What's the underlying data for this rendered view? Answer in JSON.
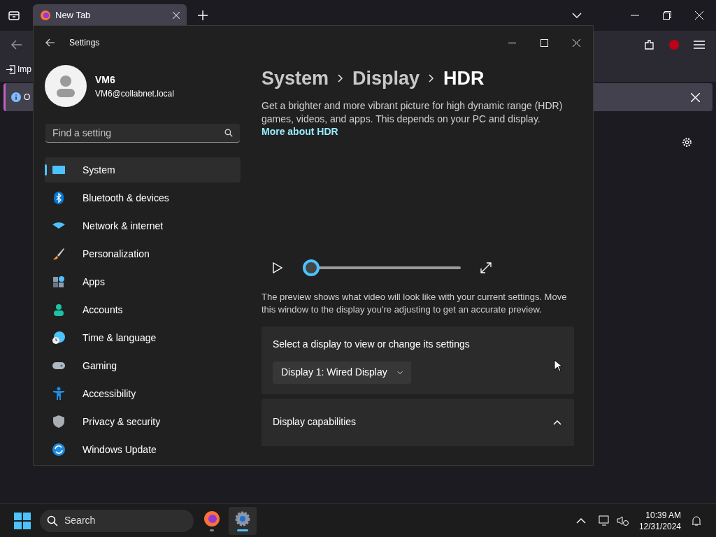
{
  "browser": {
    "tab": {
      "title": "New Tab",
      "selected": true
    },
    "bookmark": "Imp",
    "infobar": "O"
  },
  "settings": {
    "title": "Settings",
    "user": {
      "name": "VM6",
      "email": "VM6@collabnet.local"
    },
    "search": {
      "placeholder": "Find a setting"
    },
    "nav": [
      {
        "label": "System",
        "selected": true
      },
      {
        "label": "Bluetooth & devices",
        "selected": false
      },
      {
        "label": "Network & internet",
        "selected": false
      },
      {
        "label": "Personalization",
        "selected": false
      },
      {
        "label": "Apps",
        "selected": false
      },
      {
        "label": "Accounts",
        "selected": false
      },
      {
        "label": "Time & language",
        "selected": false
      },
      {
        "label": "Gaming",
        "selected": false
      },
      {
        "label": "Accessibility",
        "selected": false
      },
      {
        "label": "Privacy & security",
        "selected": false
      },
      {
        "label": "Windows Update",
        "selected": false
      }
    ],
    "breadcrumb": [
      "System",
      "Display",
      "HDR"
    ],
    "description": "Get a brighter and more vibrant picture for high dynamic range (HDR) games, videos, and apps. This depends on your PC and display.",
    "link": "More about HDR",
    "player": {
      "level": 0
    },
    "preview_note": "The preview shows what video will look like with your current settings. Move this window to the display you're adjusting to get an accurate preview.",
    "display_card": {
      "label": "Select a display to view or change its settings",
      "value": "Display 1: Wired Display"
    },
    "capabilities": {
      "label": "Display capabilities",
      "expanded": true
    }
  },
  "taskbar": {
    "search": "Search",
    "apps": [
      {
        "kind": "browser",
        "selected": false
      },
      {
        "kind": "settings",
        "selected": true
      }
    ],
    "time": "10:39 AM",
    "date": "12/31/2024"
  }
}
